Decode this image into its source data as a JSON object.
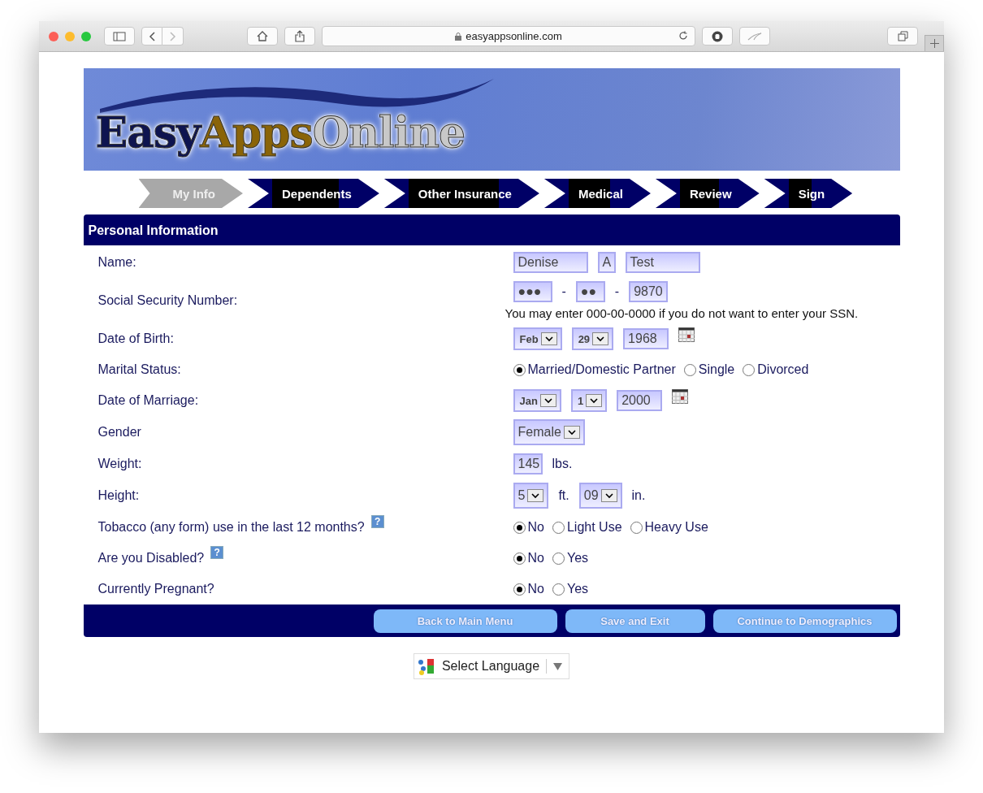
{
  "browser": {
    "url": "easyappsonline.com"
  },
  "logo": [
    "Easy",
    "Apps",
    "Online"
  ],
  "steps": [
    {
      "label": "My Info",
      "selected": true
    },
    {
      "label": "Dependents",
      "selected": false
    },
    {
      "label": "Other Insurance",
      "selected": false
    },
    {
      "label": "Medical",
      "selected": false
    },
    {
      "label": "Review",
      "selected": false
    },
    {
      "label": "Sign",
      "selected": false
    }
  ],
  "section_title": "Personal Information",
  "rows": [
    {
      "label": "Name:",
      "controls": [
        {
          "kind": "input",
          "value": "Denise"
        },
        {
          "kind": "input",
          "value": "A"
        },
        {
          "kind": "input",
          "value": "Test"
        }
      ]
    },
    {
      "label": "Social Security Number:",
      "note": "You may enter 000-00-0000 if you do not want to enter your SSN.",
      "controls": [
        {
          "kind": "input",
          "value": "●●●"
        },
        {
          "kind": "text",
          "text": "-"
        },
        {
          "kind": "input",
          "value": "●●"
        },
        {
          "kind": "text",
          "text": "-"
        },
        {
          "kind": "input",
          "value": "9870"
        }
      ]
    },
    {
      "label": "Date of Birth:",
      "controls": [
        {
          "kind": "select",
          "value": "Feb"
        },
        {
          "kind": "select",
          "value": "29"
        },
        {
          "kind": "input",
          "value": "1968"
        },
        {
          "kind": "calendar"
        }
      ]
    },
    {
      "label": "Marital Status:",
      "controls": [
        {
          "kind": "radio",
          "label": "Married/Domestic Partner",
          "selected": true
        },
        {
          "kind": "radio",
          "label": "Single",
          "selected": false
        },
        {
          "kind": "radio",
          "label": "Divorced",
          "selected": false
        }
      ]
    },
    {
      "label": "Date of Marriage:",
      "controls": [
        {
          "kind": "select",
          "value": "Jan"
        },
        {
          "kind": "select",
          "value": "1"
        },
        {
          "kind": "input",
          "value": "2000"
        },
        {
          "kind": "calendar"
        }
      ]
    },
    {
      "label": "Gender",
      "controls": [
        {
          "kind": "select",
          "value": "Female"
        }
      ]
    },
    {
      "label": "Weight:",
      "controls": [
        {
          "kind": "input",
          "value": "145"
        },
        {
          "kind": "text",
          "text": "lbs."
        }
      ]
    },
    {
      "label": "Height:",
      "controls": [
        {
          "kind": "select",
          "value": "5"
        },
        {
          "kind": "text",
          "text": "ft."
        },
        {
          "kind": "select",
          "value": "09"
        },
        {
          "kind": "text",
          "text": "in."
        }
      ]
    },
    {
      "label": "Tobacco (any form) use in the last 12 months?",
      "help": "?",
      "controls": [
        {
          "kind": "radio",
          "label": "No",
          "selected": true
        },
        {
          "kind": "radio",
          "label": "Light Use",
          "selected": false
        },
        {
          "kind": "radio",
          "label": "Heavy Use",
          "selected": false
        }
      ]
    },
    {
      "label": "Are you Disabled?",
      "help": "?",
      "controls": [
        {
          "kind": "radio",
          "label": "No",
          "selected": true
        },
        {
          "kind": "radio",
          "label": "Yes",
          "selected": false
        }
      ]
    },
    {
      "label": "Currently Pregnant?",
      "controls": [
        {
          "kind": "radio",
          "label": "No",
          "selected": true
        },
        {
          "kind": "radio",
          "label": "Yes",
          "selected": false
        }
      ]
    }
  ],
  "buttons": [
    "Back to Main Menu",
    "Save and Exit",
    "Continue to Demographics"
  ],
  "language": "Select Language"
}
